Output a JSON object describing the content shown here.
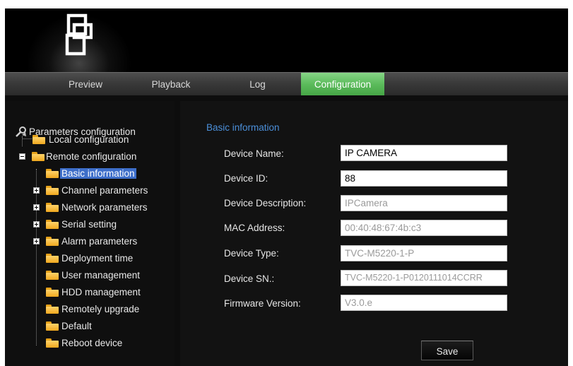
{
  "nav": {
    "tabs": [
      {
        "label": "Preview"
      },
      {
        "label": "Playback"
      },
      {
        "label": "Log"
      },
      {
        "label": "Configuration",
        "active": true
      }
    ]
  },
  "sidebar": {
    "root": "Parameters configuration",
    "local": "Local configuration",
    "remote": "Remote configuration",
    "items": [
      {
        "label": "Basic information",
        "selected": true
      },
      {
        "label": "Channel parameters",
        "expandable": true
      },
      {
        "label": "Network parameters",
        "expandable": true
      },
      {
        "label": "Serial setting",
        "expandable": true
      },
      {
        "label": "Alarm parameters",
        "expandable": true
      },
      {
        "label": "Deployment time"
      },
      {
        "label": "User management"
      },
      {
        "label": "HDD management"
      },
      {
        "label": "Remotely upgrade"
      },
      {
        "label": "Default"
      },
      {
        "label": "Reboot device"
      }
    ]
  },
  "main": {
    "section_title": "Basic information",
    "fields": [
      {
        "label": "Device Name:",
        "value": "IP CAMERA",
        "editable": true
      },
      {
        "label": "Device ID:",
        "value": "88",
        "editable": true
      },
      {
        "label": "Device Description:",
        "value": "IPCamera",
        "editable": false
      },
      {
        "label": "MAC Address:",
        "value": "00:40:48:67:4b:c3",
        "editable": false
      },
      {
        "label": "Device Type:",
        "value": "TVC-M5220-1-P",
        "editable": false
      },
      {
        "label": "Device SN.:",
        "value": "TVC-M5220-1-P0120111014CCRR",
        "editable": false
      },
      {
        "label": "Firmware Version:",
        "value": "V3.0.e",
        "editable": false
      }
    ],
    "save_label": "Save"
  },
  "colors": {
    "active_tab": "#5cbb5c",
    "section_title": "#4b8fd9",
    "selected_item": "#3d6ec9",
    "folder": "#f0a81e"
  },
  "icons": {
    "logo": "interlogix-logo-icon",
    "root": "tools-icon",
    "folder": "folder-icon",
    "expand": "expand-plus-icon",
    "collapse": "collapse-minus-icon"
  }
}
